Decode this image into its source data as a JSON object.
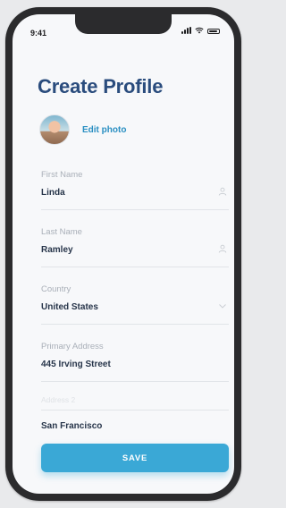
{
  "status_bar": {
    "time": "9:41"
  },
  "header": {
    "title": "Create Profile"
  },
  "profile_photo": {
    "edit_label": "Edit photo"
  },
  "form": {
    "first_name": {
      "label": "First Name",
      "value": "Linda"
    },
    "last_name": {
      "label": "Last Name",
      "value": "Ramley"
    },
    "country": {
      "label": "Country",
      "value": "United States"
    },
    "primary_address": {
      "label": "Primary Address",
      "value": "445 Irving Street"
    },
    "address2": {
      "placeholder": "Address 2"
    },
    "city": {
      "value": "San Francisco"
    }
  },
  "actions": {
    "save_label": "SAVE"
  },
  "colors": {
    "title": "#2a4c7d",
    "accent": "#3aa8d6",
    "link": "#2a8fc2",
    "frame": "#2b2b2d"
  },
  "icons": {
    "first_name": "user-icon",
    "last_name": "user-icon",
    "country": "chevron-down-icon"
  }
}
